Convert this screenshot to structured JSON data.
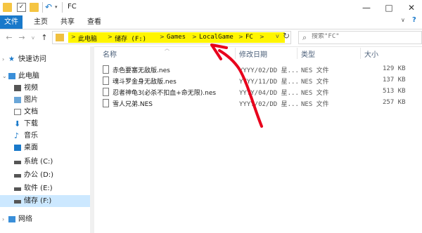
{
  "window": {
    "title": "FC"
  },
  "ribbon": {
    "tabs": [
      "文件",
      "主页",
      "共享",
      "查看"
    ],
    "active_tab": 0,
    "help": "?"
  },
  "window_buttons": {
    "minimize": "—",
    "maximize": "□",
    "close": "✕"
  },
  "address": {
    "crumbs": [
      "此电脑",
      "储存 (F:)",
      "Games",
      "LocalGame",
      "FC"
    ]
  },
  "search": {
    "placeholder": "搜索\"FC\""
  },
  "nav_icons": {
    "back": "←",
    "forward": "→",
    "recent": "v",
    "up": "↑",
    "refresh": "↻",
    "dropdown": "v",
    "search": "⌕"
  },
  "sidebar": {
    "items": [
      {
        "label": "快速访问",
        "icon": "star-icon",
        "indent": 0
      },
      {
        "label": "此电脑",
        "icon": "computer-icon",
        "indent": 0
      },
      {
        "label": "视频",
        "icon": "video-icon",
        "indent": 1
      },
      {
        "label": "图片",
        "icon": "picture-icon",
        "indent": 1
      },
      {
        "label": "文档",
        "icon": "document-icon",
        "indent": 1
      },
      {
        "label": "下载",
        "icon": "download-icon",
        "indent": 1
      },
      {
        "label": "音乐",
        "icon": "music-icon",
        "indent": 1
      },
      {
        "label": "桌面",
        "icon": "desktop-icon",
        "indent": 1
      },
      {
        "label": "系统 (C:)",
        "icon": "drive-icon",
        "indent": 1
      },
      {
        "label": "办公 (D:)",
        "icon": "drive-icon",
        "indent": 1
      },
      {
        "label": "软件 (E:)",
        "icon": "drive-icon",
        "indent": 1
      },
      {
        "label": "储存 (F:)",
        "icon": "drive-icon",
        "indent": 1,
        "active": true
      },
      {
        "label": "网络",
        "icon": "network-icon",
        "indent": 0
      }
    ]
  },
  "columns": [
    "名称",
    "修改日期",
    "类型",
    "大小"
  ],
  "files": [
    {
      "name": "赤色要塞无敌版.nes",
      "date": "YYYY/02/DD 星...",
      "type": "NES 文件",
      "size": "129 KB"
    },
    {
      "name": "魂斗罗金身无敌版.nes",
      "date": "YYYY/11/DD 星...",
      "type": "NES 文件",
      "size": "137 KB"
    },
    {
      "name": "忍者神龟3(必杀不扣血+命无限).nes",
      "date": "YYYY/04/DD 星...",
      "type": "NES 文件",
      "size": "513 KB"
    },
    {
      "name": "雪人兄弟.NES",
      "date": "YYYY/02/DD 星...",
      "type": "NES 文件",
      "size": "257 KB"
    }
  ],
  "colors": {
    "accent": "#1979ca",
    "highlight": "#fff500",
    "annotation": "#e8001c",
    "folder": "#f5c542",
    "selected": "#cce8ff"
  }
}
